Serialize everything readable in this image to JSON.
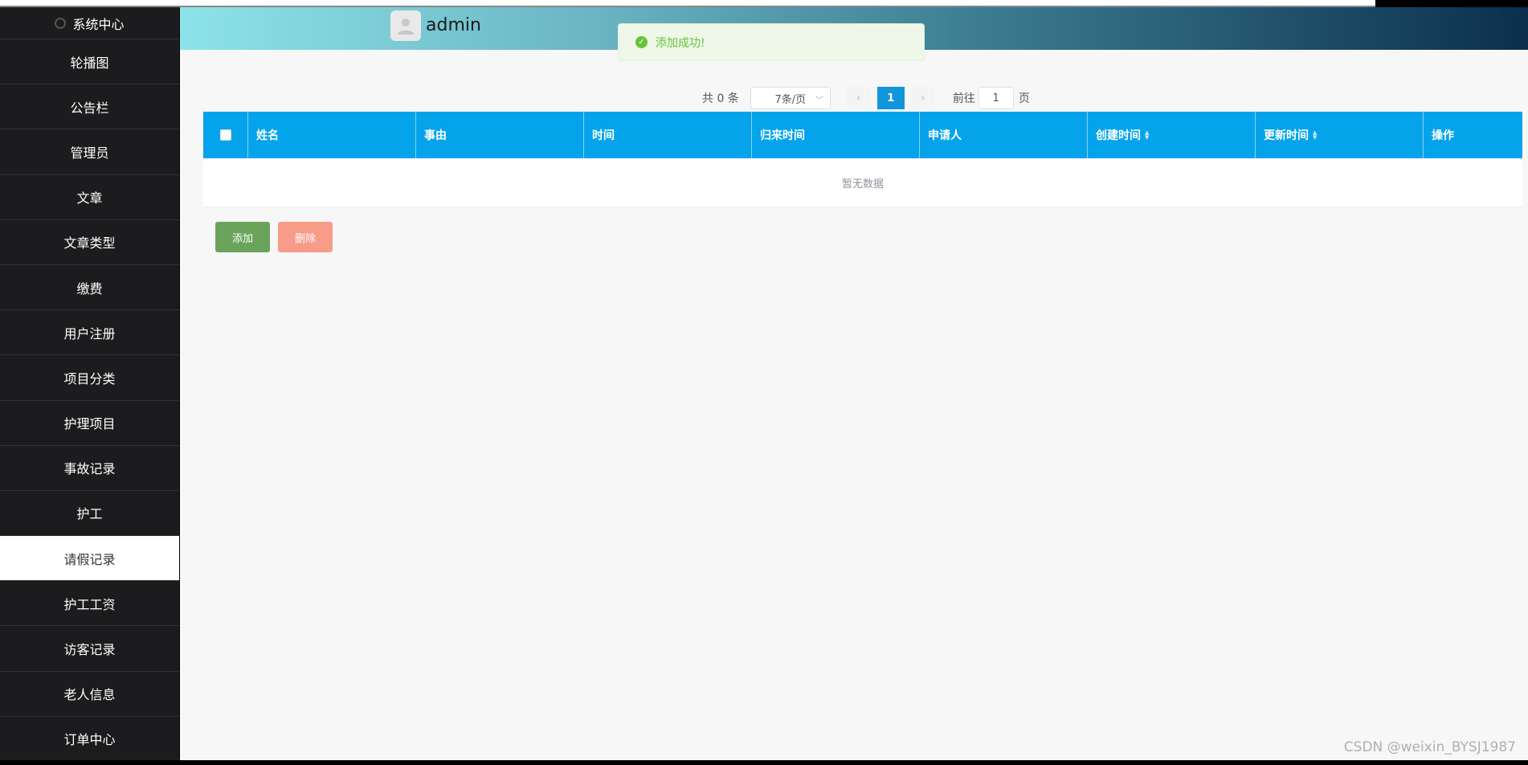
{
  "header": {
    "username": "admin"
  },
  "sidebar": {
    "items": [
      {
        "label": "系统中心",
        "first": true
      },
      {
        "label": "轮播图"
      },
      {
        "label": "公告栏"
      },
      {
        "label": "管理员"
      },
      {
        "label": "文章"
      },
      {
        "label": "文章类型"
      },
      {
        "label": "缴费"
      },
      {
        "label": "用户注册"
      },
      {
        "label": "项目分类"
      },
      {
        "label": "护理项目"
      },
      {
        "label": "事故记录"
      },
      {
        "label": "护工"
      },
      {
        "label": "请假记录",
        "active": true
      },
      {
        "label": "护工工资"
      },
      {
        "label": "访客记录"
      },
      {
        "label": "老人信息"
      },
      {
        "label": "订单中心"
      }
    ]
  },
  "toast": {
    "message": "添加成功!"
  },
  "pager": {
    "total": "共 0 条",
    "page_size": "7条/页",
    "current_page": "1",
    "goto_label": "前往",
    "goto_value": "1",
    "goto_suffix": "页"
  },
  "table": {
    "columns": [
      "姓名",
      "事由",
      "时间",
      "归来时间",
      "申请人",
      "创建时间",
      "更新时间",
      "操作"
    ],
    "empty_text": "暂无数据"
  },
  "actions": {
    "add_label": "添加",
    "delete_label": "删除"
  },
  "watermark": "CSDN @weixin_BYSJ1987",
  "colors": {
    "primary": "#05a4ea",
    "success": "#67c23a",
    "add": "#6aa35a",
    "delete": "#f89c89"
  }
}
